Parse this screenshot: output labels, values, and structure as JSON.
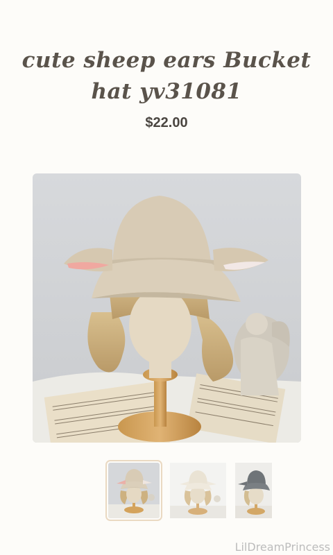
{
  "product": {
    "title_line1": "cute sheep ears Bucket",
    "title_line2": "hat yv31081",
    "price": "$22.00"
  },
  "gallery": {
    "main_image_alt": "cute sheep ears Bucket hat yv31081",
    "thumbnails": [
      {
        "alt": "thumbnail 1",
        "selected": true
      },
      {
        "alt": "thumbnail 2",
        "selected": false
      },
      {
        "alt": "thumbnail 3",
        "selected": false
      }
    ]
  },
  "footer": {
    "watermark": "LilDreamPrincess"
  },
  "colors": {
    "background": "#fdfcf9",
    "title": "#5a534b",
    "price": "#4a4540",
    "thumb_selected_border": "#ead9c2",
    "watermark": "#bcbcbc"
  }
}
